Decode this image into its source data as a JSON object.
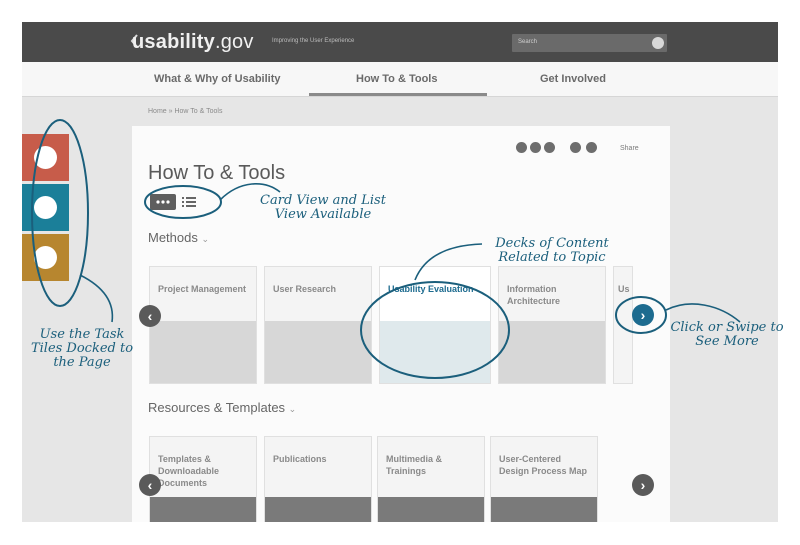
{
  "header": {
    "logo": "usability",
    "logo_tld": ".gov",
    "tagline": "Improving the User Experience",
    "search_placeholder": "Search"
  },
  "nav": {
    "items": [
      "What & Why of Usability",
      "How To & Tools",
      "Get Involved"
    ],
    "active": "How To & Tools"
  },
  "breadcrumb": "Home » How To & Tools",
  "share_label": "Share",
  "page_title": "How To & Tools",
  "sections": {
    "methods": "Methods",
    "resources": "Resources & Templates"
  },
  "methods_tiles": [
    {
      "label": "Project Management"
    },
    {
      "label": "User Research"
    },
    {
      "label": "Usability Evaluation"
    },
    {
      "label": "Information Architecture"
    },
    {
      "label": "Us De"
    }
  ],
  "resources_tiles": [
    {
      "label": "Templates & Downloadable Documents"
    },
    {
      "label": "Publications"
    },
    {
      "label": "Multimedia & Trainings"
    },
    {
      "label": "User-Centered Design Process Map"
    }
  ],
  "annotations": {
    "view": "Card View and List View Available",
    "decks": "Decks of Content Related to Topic",
    "swipe": "Click or Swipe to See More",
    "tasks": "Use the Task Tiles Docked to the Page"
  },
  "colors": {
    "task_red": "#c75c4a",
    "task_teal": "#1b7f99",
    "task_gold": "#b7862f",
    "annotation": "#1b5f7c"
  },
  "icons": {
    "task_1": "share-arrow-icon",
    "task_2": "document-icon",
    "task_3": "checklist-icon"
  }
}
